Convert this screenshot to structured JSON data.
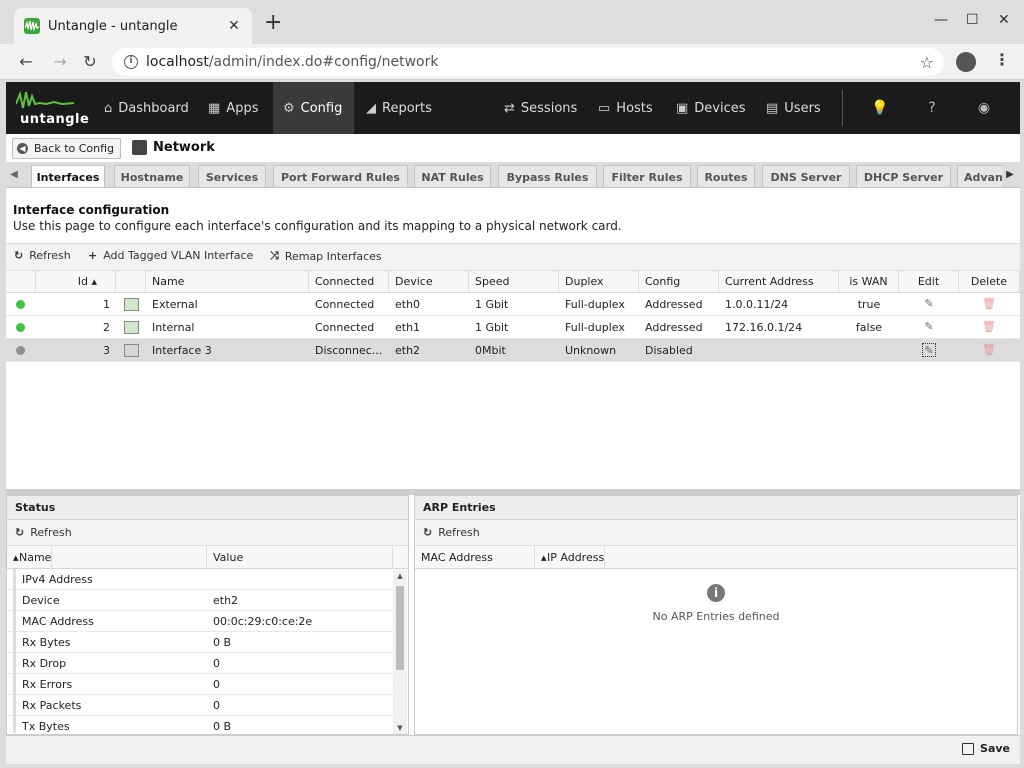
{
  "browser": {
    "tab_title": "Untangle - untangle",
    "url_host": "localhost",
    "url_path": "/admin/index.do#config/network"
  },
  "nav": {
    "logo_text": "untangle",
    "items": [
      {
        "label": "Dashboard",
        "icon": "home-icon"
      },
      {
        "label": "Apps",
        "icon": "apps-grid-icon"
      },
      {
        "label": "Config",
        "icon": "gear-icon"
      },
      {
        "label": "Reports",
        "icon": "area-chart-icon"
      },
      {
        "label": "Sessions",
        "icon": "sessions-icon"
      },
      {
        "label": "Hosts",
        "icon": "monitor-icon"
      },
      {
        "label": "Devices",
        "icon": "devices-icon"
      },
      {
        "label": "Users",
        "icon": "users-icon"
      }
    ]
  },
  "crumb": {
    "back_label": "Back to Config",
    "title": "Network"
  },
  "tabs": [
    "Interfaces",
    "Hostname",
    "Services",
    "Port Forward Rules",
    "NAT Rules",
    "Bypass Rules",
    "Filter Rules",
    "Routes",
    "DNS Server",
    "DHCP Server",
    "Advanced"
  ],
  "panel": {
    "heading": "Interface configuration",
    "description": "Use this page to configure each interface's configuration and its mapping to a physical network card."
  },
  "toolbar": {
    "refresh": "Refresh",
    "add_vlan": "Add Tagged VLAN Interface",
    "remap": "Remap Interfaces"
  },
  "grid": {
    "columns": [
      "Id",
      "Name",
      "Connected",
      "Device",
      "Speed",
      "Duplex",
      "Config",
      "Current Address",
      "is WAN",
      "Edit",
      "Delete"
    ],
    "rows": [
      {
        "status": "#3cc43c",
        "id": "1",
        "name": "External",
        "connected": "Connected",
        "device": "eth0",
        "speed": "1 Gbit",
        "duplex": "Full-duplex",
        "config": "Addressed",
        "address": "1.0.0.11/24",
        "wan": "true"
      },
      {
        "status": "#3cc43c",
        "id": "2",
        "name": "Internal",
        "connected": "Connected",
        "device": "eth1",
        "speed": "1 Gbit",
        "duplex": "Full-duplex",
        "config": "Addressed",
        "address": "172.16.0.1/24",
        "wan": "false"
      },
      {
        "status": "#8f8f8f",
        "id": "3",
        "name": "Interface 3",
        "connected": "Disconnec...",
        "device": "eth2",
        "speed": "0Mbit",
        "duplex": "Unknown",
        "config": "Disabled",
        "address": "",
        "wan": ""
      }
    ]
  },
  "status": {
    "title": "Status",
    "refresh": "Refresh",
    "col_name": "Name",
    "col_value": "Value",
    "rows": [
      {
        "k": "IPv4 Address",
        "v": ""
      },
      {
        "k": "Device",
        "v": "eth2"
      },
      {
        "k": "MAC Address",
        "v": "00:0c:29:c0:ce:2e"
      },
      {
        "k": "Rx Bytes",
        "v": "0 B"
      },
      {
        "k": "Rx Drop",
        "v": "0"
      },
      {
        "k": "Rx Errors",
        "v": "0"
      },
      {
        "k": "Rx Packets",
        "v": "0"
      },
      {
        "k": "Tx Bytes",
        "v": "0 B"
      }
    ]
  },
  "arp": {
    "title": "ARP Entries",
    "refresh": "Refresh",
    "col_mac": "MAC Address",
    "col_ip": "IP Address",
    "empty": "No ARP Entries defined"
  },
  "footer": {
    "save": "Save"
  }
}
